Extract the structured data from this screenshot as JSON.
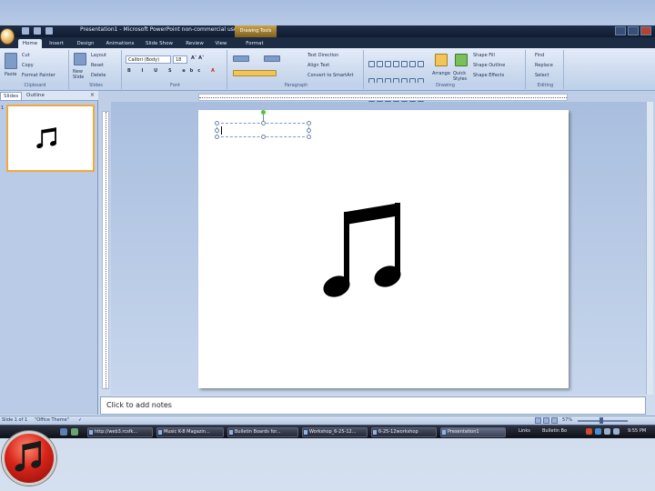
{
  "window": {
    "title": "Presentation1 - Microsoft PowerPoint non-commercial use",
    "contextual_tab": "Drawing Tools"
  },
  "tabs": [
    "Home",
    "Insert",
    "Design",
    "Animations",
    "Slide Show",
    "Review",
    "View",
    "Format"
  ],
  "active_tab": "Home",
  "ribbon": {
    "clipboard": {
      "paste": "Paste",
      "cut": "Cut",
      "copy": "Copy",
      "format_painter": "Format Painter",
      "label": "Clipboard"
    },
    "slides": {
      "new_slide": "New Slide",
      "layout": "Layout",
      "reset": "Reset",
      "delete": "Delete",
      "label": "Slides"
    },
    "font": {
      "font_name": "Calibri (Body)",
      "font_size": "18",
      "label": "Font"
    },
    "paragraph": {
      "text_direction": "Text Direction",
      "align_text": "Align Text",
      "convert_smartart": "Convert to SmartArt",
      "label": "Paragraph"
    },
    "drawing": {
      "arrange": "Arrange",
      "quick_styles": "Quick Styles",
      "shape_fill": "Shape Fill",
      "shape_outline": "Shape Outline",
      "shape_effects": "Shape Effects",
      "label": "Drawing"
    },
    "editing": {
      "find": "Find",
      "replace": "Replace",
      "select": "Select",
      "label": "Editing"
    }
  },
  "slides_pane": {
    "tab_slides": "Slides",
    "tab_outline": "Outline",
    "close": "×",
    "slide_number": "1"
  },
  "notes": {
    "placeholder": "Click to add notes"
  },
  "status": {
    "slide": "Slide 1 of 1",
    "theme": "\"Office Theme\"",
    "zoom": "57%"
  },
  "taskbar": {
    "items": [
      {
        "label": "http://web3.rcsfk..."
      },
      {
        "label": "Music K-8 Magazin..."
      },
      {
        "label": "Bulletin Boards for..."
      },
      {
        "label": "Workshop_6-25-12..."
      },
      {
        "label": "6-25-12workshop"
      },
      {
        "label": "Presentation1"
      }
    ],
    "links": "Links",
    "toolbar": "Bulletin Bo",
    "clock": "9:55 PM"
  },
  "colors": {
    "accent": "#f2a93b",
    "title_bar": "#1f2f4a",
    "ribbon": "#dbe6f4",
    "start": "#d8251a"
  }
}
